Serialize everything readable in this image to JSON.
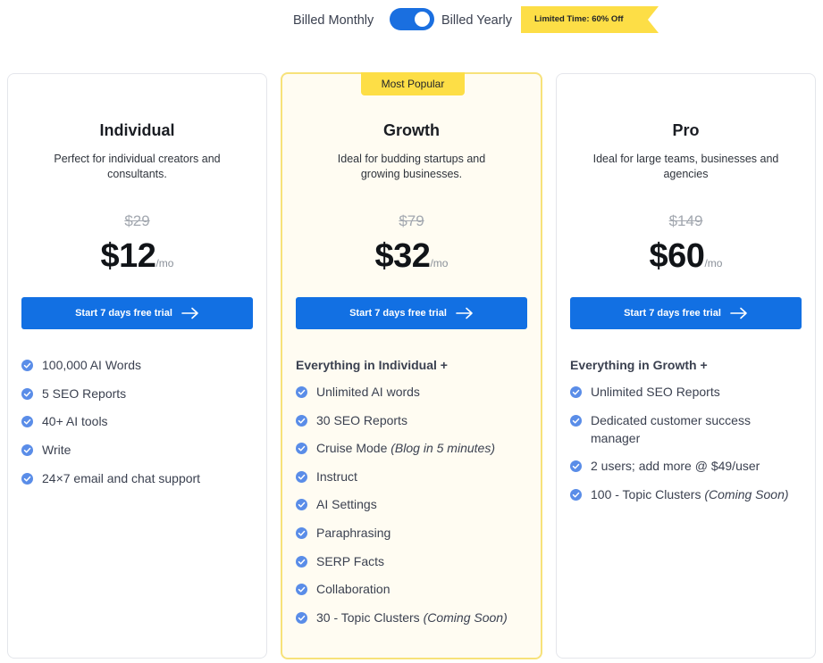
{
  "billing": {
    "monthly_label": "Billed Monthly",
    "yearly_label": "Billed Yearly",
    "toggle_state": "yearly",
    "promo": "Limited Time: 60% Off"
  },
  "colors": {
    "accent": "#1270e3",
    "badge_yellow": "#fdde46",
    "highlight_bg": "#fffcf2",
    "check": "#5a8de8"
  },
  "plans": [
    {
      "name": "Individual",
      "description": "Perfect for individual creators and consultants.",
      "old_price": "$29",
      "price": "$12",
      "per": "/mo",
      "cta": "Start 7 days free trial",
      "features": [
        "100,000 AI Words",
        "5 SEO Reports",
        "40+ AI tools",
        "Write",
        "24×7 email and chat support"
      ]
    },
    {
      "name": "Growth",
      "badge": "Most Popular",
      "description": "Ideal for budding startups and growing businesses.",
      "old_price": "$79",
      "price": "$32",
      "per": "/mo",
      "cta": "Start 7 days free trial",
      "features_heading": "Everything in Individual +",
      "features": [
        "Unlimited AI words",
        "30 SEO Reports",
        "Cruise Mode",
        "Instruct",
        "AI Settings",
        "Paraphrasing",
        "SERP Facts",
        "Collaboration",
        "30 - Topic Clusters"
      ],
      "feature_notes": {
        "cruise": "(Blog in 5 minutes)",
        "clusters": "(Coming Soon)"
      }
    },
    {
      "name": "Pro",
      "description": "Ideal for large teams, businesses and agencies",
      "old_price": "$149",
      "price": "$60",
      "per": "/mo",
      "cta": "Start 7 days free trial",
      "features_heading": "Everything in Growth +",
      "features": [
        "Unlimited SEO Reports",
        "Dedicated customer success manager",
        "2 users; add more @ $49/user",
        "100 - Topic Clusters"
      ],
      "feature_notes": {
        "clusters": "(Coming Soon)"
      }
    }
  ]
}
